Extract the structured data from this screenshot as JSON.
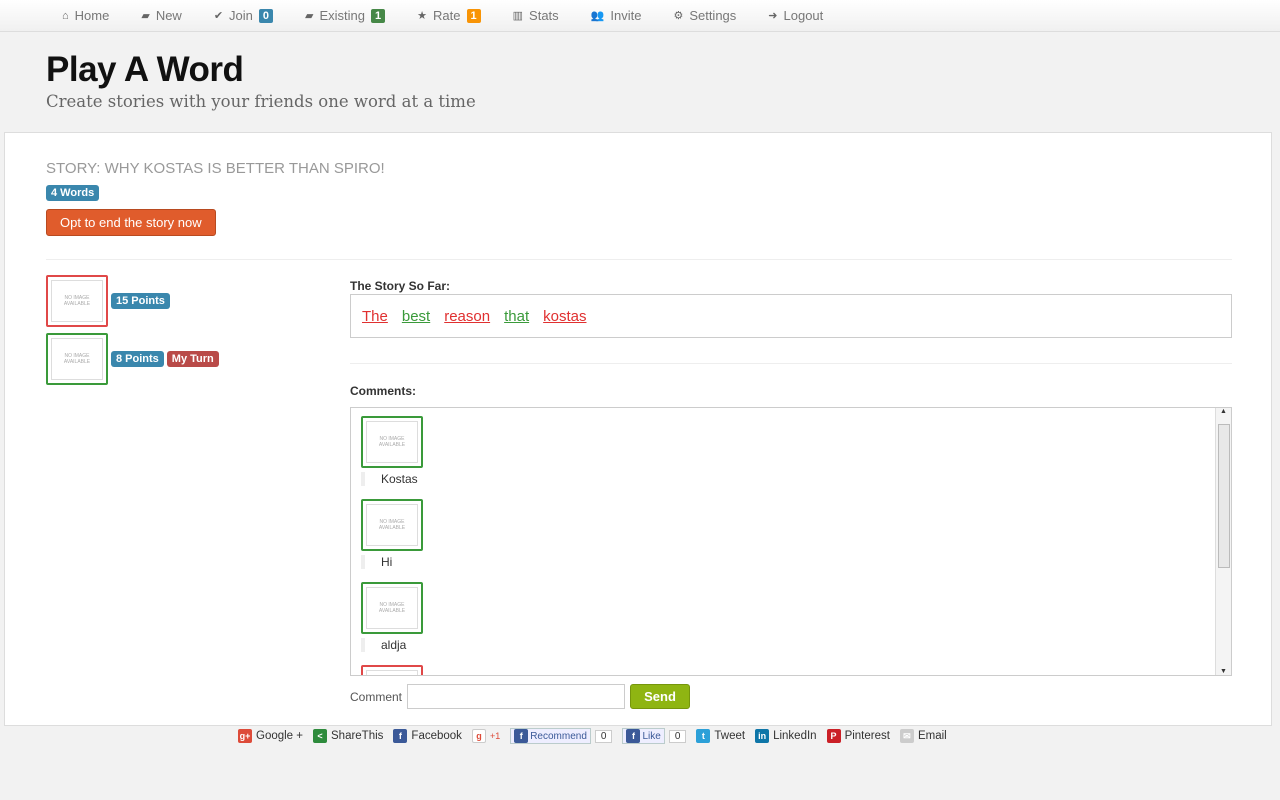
{
  "nav": [
    {
      "icon": "home-icon",
      "glyph": "⌂",
      "label": "Home"
    },
    {
      "icon": "book-icon",
      "glyph": "▰",
      "label": "New"
    },
    {
      "icon": "check-icon",
      "glyph": "✔",
      "label": "Join",
      "count": "0",
      "count_color": "#3a87ad"
    },
    {
      "icon": "book-icon",
      "glyph": "▰",
      "label": "Existing",
      "count": "1",
      "count_color": "#468847"
    },
    {
      "icon": "star-icon",
      "glyph": "★",
      "label": "Rate",
      "count": "1",
      "count_color": "#f89406"
    },
    {
      "icon": "bar-chart-icon",
      "glyph": "▥",
      "label": "Stats"
    },
    {
      "icon": "group-icon",
      "glyph": "👥",
      "label": "Invite"
    },
    {
      "icon": "gear-icon",
      "glyph": "⚙",
      "label": "Settings"
    },
    {
      "icon": "logout-icon",
      "glyph": "➜",
      "label": "Logout"
    }
  ],
  "header": {
    "title": "Play A Word",
    "subtitle": "Create stories with your friends one word at a time"
  },
  "story": {
    "title": "STORY: WHY KOSTAS IS BETTER THAN SPIRO!",
    "word_count": "4 Words",
    "end_button": "Opt to end the story now",
    "so_far_label": "The Story So Far:",
    "words": [
      {
        "w": "The",
        "color": "#e03030"
      },
      {
        "w": "best",
        "color": "#3a9a3a"
      },
      {
        "w": "reason",
        "color": "#e03030"
      },
      {
        "w": "that",
        "color": "#3a9a3a"
      },
      {
        "w": "kostas",
        "color": "#e03030"
      }
    ]
  },
  "avatar_placeholder": "NO IMAGE AVAILABLE",
  "players": [
    {
      "points": "15 Points",
      "color": "#e04848"
    },
    {
      "points": "8 Points",
      "turn": "My Turn",
      "color": "#3a9a3a"
    }
  ],
  "comments": {
    "label": "Comments:",
    "items": [
      {
        "text": "Kostas",
        "color": "#3a9a3a"
      },
      {
        "text": "Hi",
        "color": "#3a9a3a"
      },
      {
        "text": "aldja",
        "color": "#3a9a3a"
      },
      {
        "text": "",
        "color": "#e04848"
      }
    ],
    "input_label": "Comment",
    "input_value": "",
    "send": "Send"
  },
  "footer": [
    {
      "icon": "google-plus-icon",
      "label": "Google +",
      "color": "#dd4b39",
      "g": "g+"
    },
    {
      "icon": "sharethis-icon",
      "label": "ShareThis",
      "color": "#2e8b3c",
      "g": "<"
    },
    {
      "icon": "facebook-icon",
      "label": "Facebook",
      "color": "#3b5998",
      "g": "f"
    },
    {
      "icon": "plus-one-icon",
      "label": "+1",
      "color": "#ffffff",
      "g": "g"
    },
    {
      "icon": "facebook-icon",
      "label": "Recommend",
      "color": "#3b5998",
      "g": "f",
      "count": "0"
    },
    {
      "icon": "facebook-icon",
      "label": "Like",
      "color": "#3b5998",
      "g": "f",
      "count": "0"
    },
    {
      "icon": "twitter-icon",
      "label": "Tweet",
      "color": "#2ca0d8",
      "g": "t"
    },
    {
      "icon": "linkedin-icon",
      "label": "LinkedIn",
      "color": "#0e76a8",
      "g": "in"
    },
    {
      "icon": "pinterest-icon",
      "label": "Pinterest",
      "color": "#cb2027",
      "g": "P"
    },
    {
      "icon": "email-icon",
      "label": "Email",
      "color": "#cccccc",
      "g": "✉"
    }
  ]
}
